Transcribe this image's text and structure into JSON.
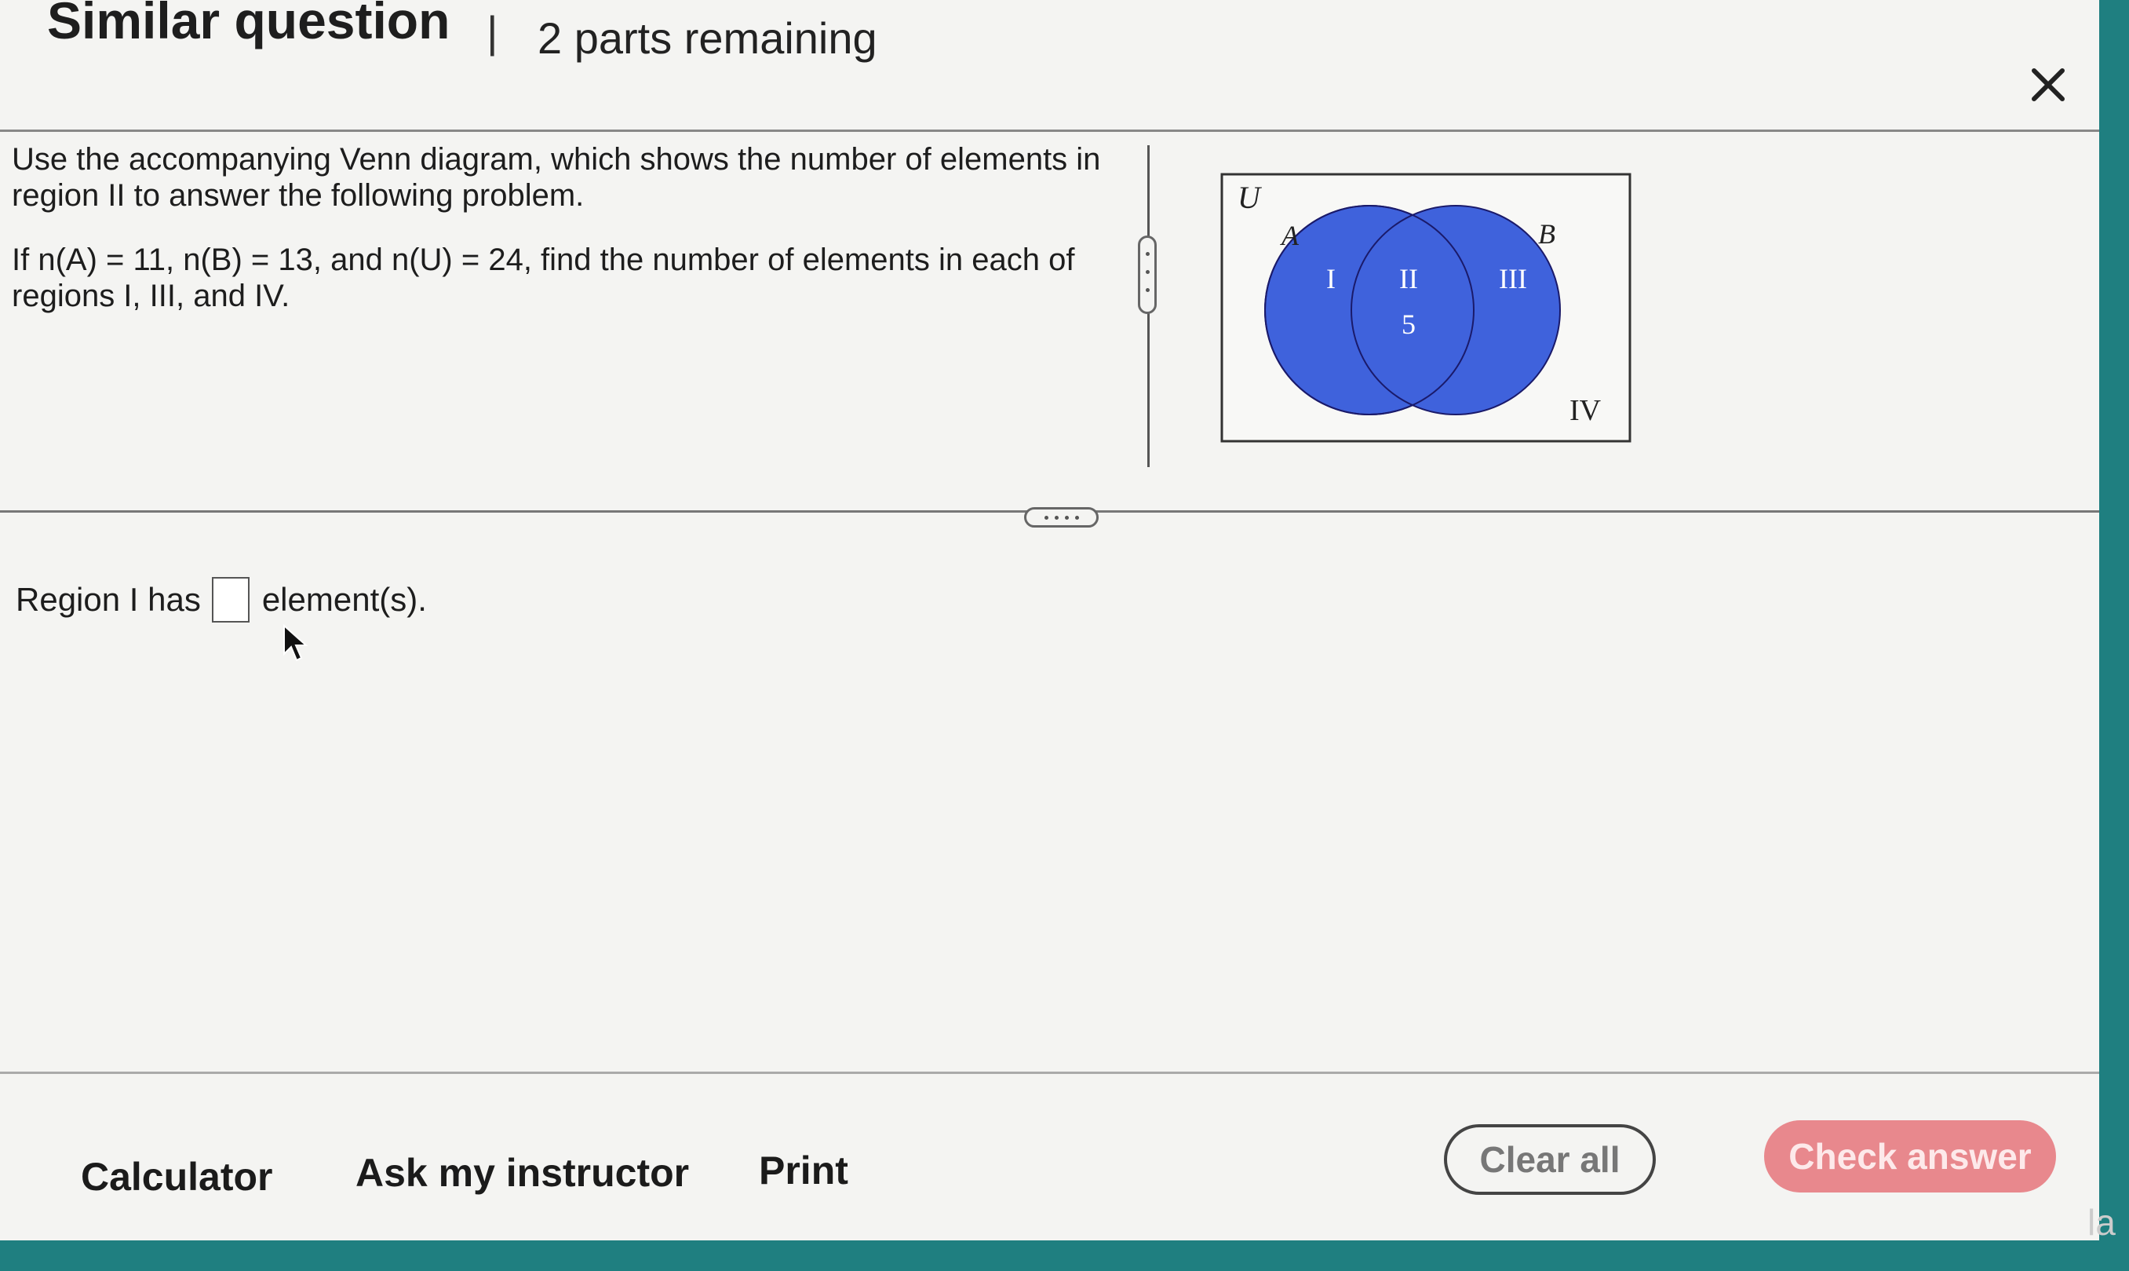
{
  "header": {
    "title": "Similar question",
    "separator": "|",
    "subtitle": "2 parts remaining"
  },
  "question": {
    "line1": "Use the accompanying Venn diagram, which shows the number of elements in region II to answer the following problem.",
    "line2_html": "If n(A) = 11, n(B) = 13, and n(U) = 24, find the number of elements in each of regions I, III, and IV."
  },
  "venn": {
    "universe_label": "U",
    "set_a_label": "A",
    "set_b_label": "B",
    "region_1": "I",
    "region_2": "II",
    "region_2_value": "5",
    "region_3": "III",
    "region_4": "IV",
    "fill_color": "#3f62dc",
    "stroke_color": "#1a1a6a"
  },
  "answer": {
    "prefix": "Region I has",
    "suffix": "element(s).",
    "value": ""
  },
  "footer": {
    "calculator": "Calculator",
    "ask_instructor": "Ask my instructor",
    "print": "Print",
    "clear_all": "Clear all",
    "check_answer": "Check answer"
  },
  "edge_text": "la",
  "colors": {
    "accent_check": "#e8888d",
    "background": "#f4f4f2",
    "frame": "#1f7f80"
  }
}
